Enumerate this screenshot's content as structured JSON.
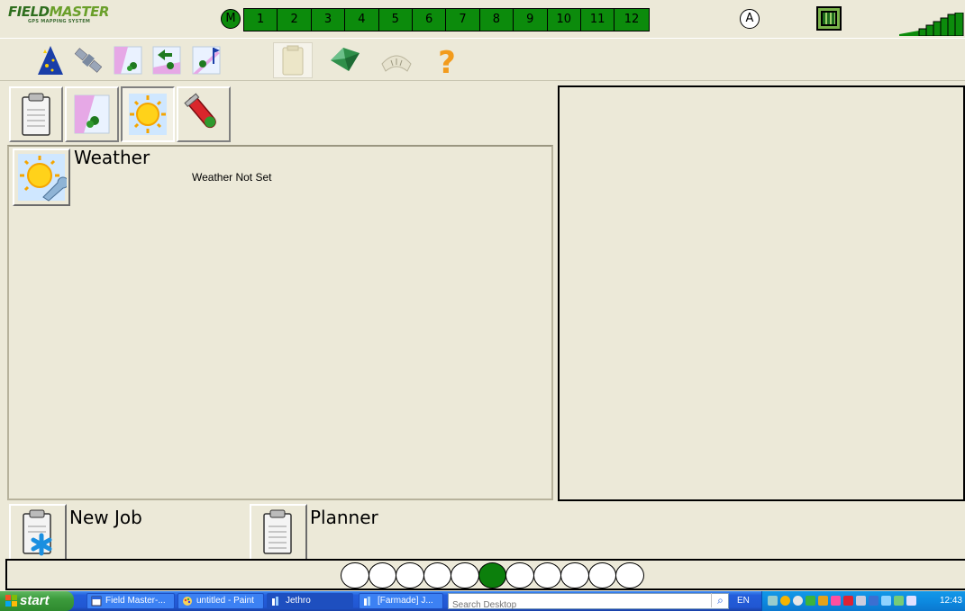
{
  "app": {
    "logo_text_1": "FIELD",
    "logo_text_2": "MASTER",
    "logo_sub": "GPS MAPPING SYSTEM"
  },
  "topbar": {
    "mode_left": "M",
    "mode_right": "A",
    "sections": [
      "1",
      "2",
      "3",
      "4",
      "5",
      "6",
      "7",
      "8",
      "9",
      "10",
      "11",
      "12"
    ],
    "section_color": "#0c8b0c",
    "boom_icon": "boom-sections-icon",
    "signal_icon": "gps-signal-icon"
  },
  "toolbar": {
    "tools": [
      {
        "name": "wizard-icon"
      },
      {
        "name": "satellite-icon"
      },
      {
        "name": "field-map-icon"
      },
      {
        "name": "field-entry-icon"
      },
      {
        "name": "field-flag-icon"
      },
      {
        "name": "clipboard-icon",
        "active": true
      },
      {
        "name": "leaf-icon"
      },
      {
        "name": "gauge-icon"
      },
      {
        "name": "help-icon"
      }
    ]
  },
  "subtabs": [
    {
      "name": "clipboard-icon"
    },
    {
      "name": "field-map-icon"
    },
    {
      "name": "weather-sun-icon",
      "active": true
    },
    {
      "name": "test-tube-icon"
    }
  ],
  "weather": {
    "title": "Weather",
    "status": "Weather Not Set"
  },
  "actions": {
    "new_job": "New Job",
    "planner": "Planner"
  },
  "pager": {
    "count": 11,
    "active_index": 5
  },
  "taskbar": {
    "start": "start",
    "tasks": [
      {
        "label": "Field Master-..."
      },
      {
        "label": "untitled - Paint"
      },
      {
        "label": "Jethro",
        "pressed": true
      },
      {
        "label": "[Farmade] J..."
      }
    ],
    "search_placeholder": "Search Desktop",
    "lang": "EN",
    "clock": "12:43"
  }
}
